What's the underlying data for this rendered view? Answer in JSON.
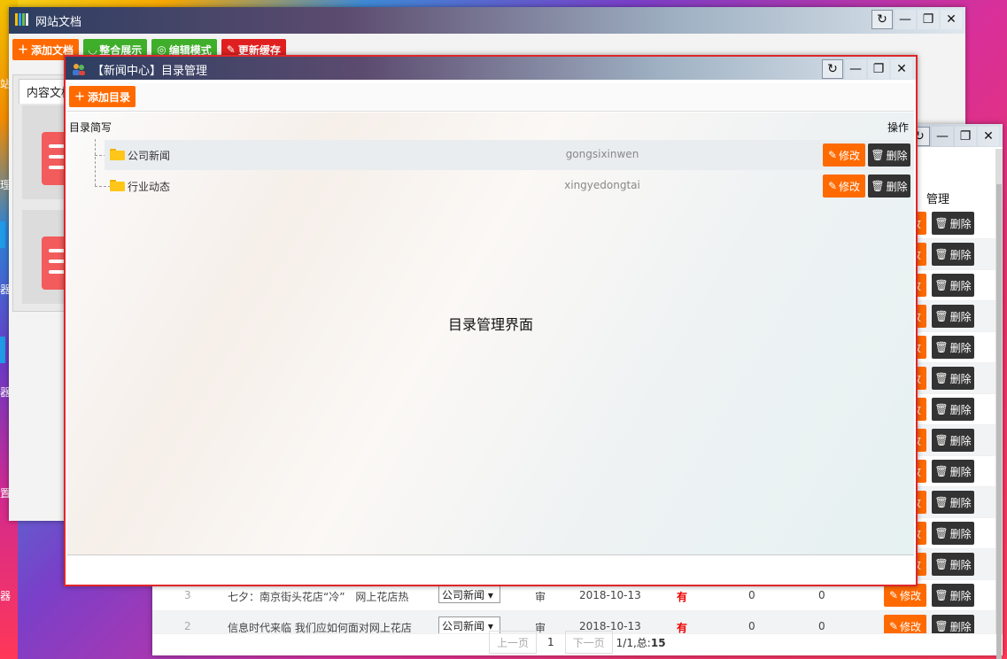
{
  "desktop": {
    "side_labels": [
      "站",
      "理",
      "器",
      "器",
      "置",
      "器"
    ]
  },
  "docs_window": {
    "title": "网站文档",
    "toolbar": {
      "add_doc": "添加文档",
      "combine_show": "整合展示",
      "edit_mode": "编辑模式",
      "update_cache": "更新缓存"
    },
    "panel_tab": "内容文档"
  },
  "list_window": {
    "header_manage": "管理",
    "row_mod_label": "修改",
    "row_del_label": "删除",
    "visible_rows": [
      {
        "id": "3",
        "title": "七夕：南京街头花店“冷”　网上花店热",
        "category": "公司新闻",
        "status": "审",
        "date": "2018-10-13",
        "flag": "有",
        "c1": "0",
        "c2": "0"
      },
      {
        "id": "2",
        "title": "信息时代来临 我们应如何面对网上花店",
        "category": "公司新闻",
        "status": "审",
        "date": "2018-10-13",
        "flag": "有",
        "c1": "0",
        "c2": "0"
      }
    ],
    "pager": {
      "prev": "上一页",
      "page": "1",
      "next": "下一页",
      "info_prefix": "1/1,总:",
      "total": "15"
    }
  },
  "dir_window": {
    "title": "【新闻中心】目录管理",
    "add_button": "添加目录",
    "col_abbr": "目录简写",
    "col_ops": "操作",
    "items": [
      {
        "name": "公司新闻",
        "abbr": "gongsixinwen",
        "edit": "修改",
        "delete": "删除"
      },
      {
        "name": "行业动态",
        "abbr": "xingyedongtai",
        "edit": "修改",
        "delete": "删除"
      }
    ],
    "center_text": "目录管理界面"
  },
  "colors": {
    "accent_orange": "#ff6a00",
    "dark_button": "#333333",
    "modal_border": "#e0262b",
    "green_button": "#3fae2a",
    "red_button": "#e02020"
  }
}
